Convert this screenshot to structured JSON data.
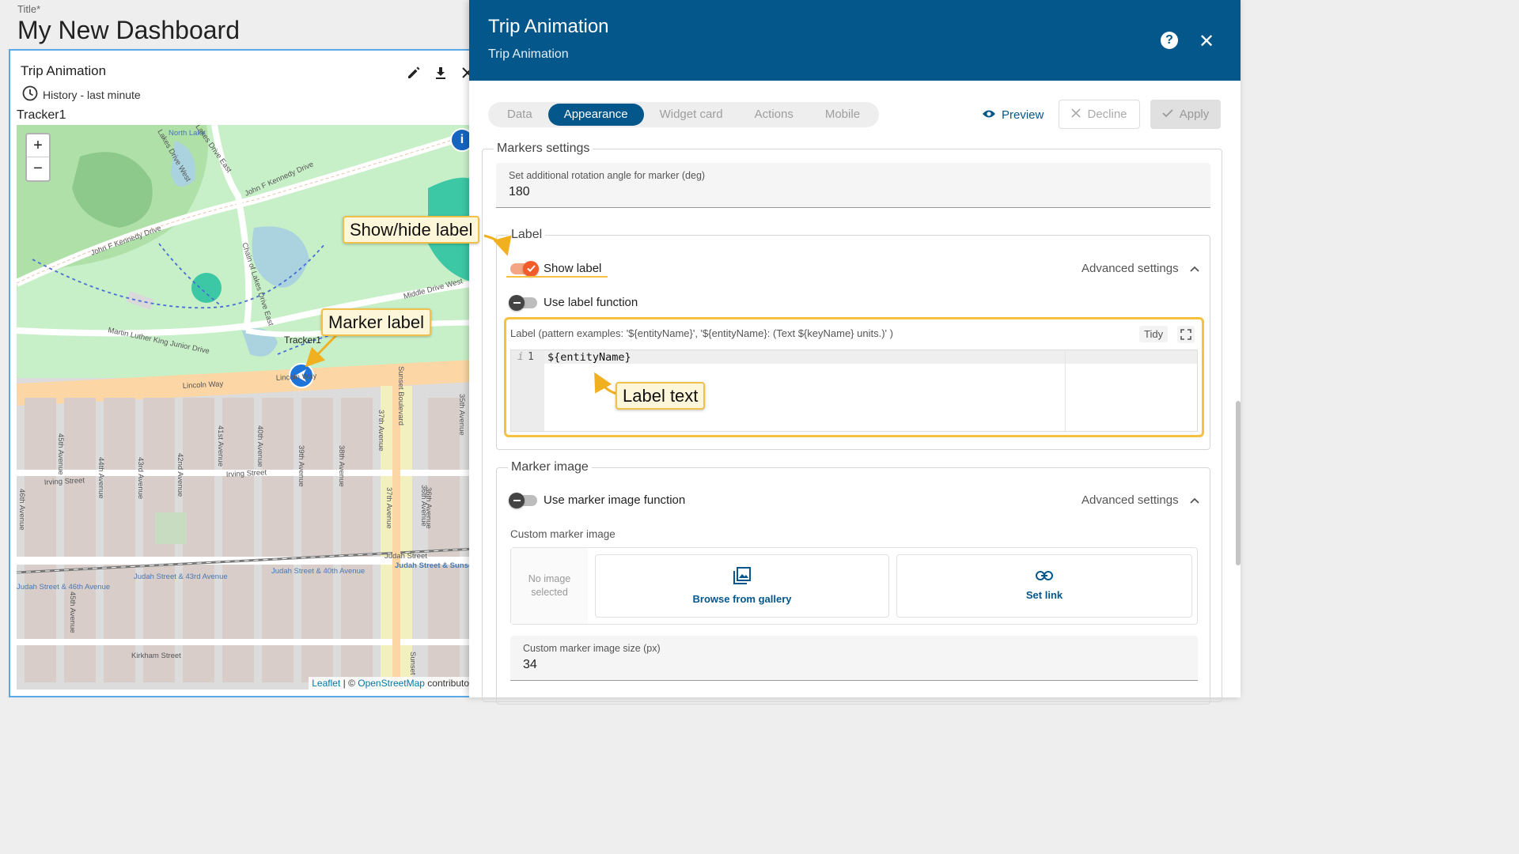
{
  "dashboard": {
    "title_label": "Title*",
    "title": "My New Dashboard"
  },
  "widget": {
    "title": "Trip Animation",
    "timewindow": "History - last minute",
    "entity_name": "Tracker1",
    "actions": [
      "edit-icon",
      "download-icon",
      "close-icon"
    ]
  },
  "map": {
    "zoom_in": "+",
    "zoom_out": "−",
    "marker_label": "Tracker1",
    "info_glyph": "i",
    "attribution": {
      "leaflet": "Leaflet",
      "separator": " | © ",
      "osm": "OpenStreetMap",
      "suffix": " contributor"
    },
    "streets": [
      "John F Kennedy Drive",
      "John F Kennedy Drive",
      "Chain of Lakes Drive East",
      "Middle Drive West",
      "Martin Luther King Junior Drive",
      "Lincoln Way",
      "Lincoln Way",
      "Irving Street",
      "Irving Street",
      "Judah Street",
      "Kirkham Street",
      "Sunset Boulevard",
      "45th Avenue",
      "44th Avenue",
      "43rd Avenue",
      "42nd Avenue",
      "41st Avenue",
      "40th Avenue",
      "39th Avenue",
      "38th Avenue",
      "37th Avenue",
      "36th Avenue",
      "35th Avenue",
      "46th Avenue",
      "Lakes Drive West",
      "Lakes Drive East",
      "North Lake",
      "Judah Street & 43rd Avenue",
      "Judah Street & 40th Avenue",
      "Judah Street & Sunset Boulevard",
      "Judah Street & 46th Avenue",
      "45th Avenue",
      "37th Avenue",
      "36th Avenue",
      "Sunset"
    ]
  },
  "dialog": {
    "title": "Trip Animation",
    "subtitle": "Trip Animation",
    "help_glyph": "?",
    "close_glyph": "✕",
    "tabs": [
      {
        "label": "Data",
        "active": false
      },
      {
        "label": "Appearance",
        "active": true
      },
      {
        "label": "Widget card",
        "active": false
      },
      {
        "label": "Actions",
        "active": false
      },
      {
        "label": "Mobile",
        "active": false
      }
    ],
    "preview_label": "Preview",
    "decline_label": "Decline",
    "apply_label": "Apply"
  },
  "markers_settings": {
    "legend": "Markers settings",
    "rotation": {
      "label": "Set additional rotation angle for marker (deg)",
      "value": "180"
    }
  },
  "label_section": {
    "legend": "Label",
    "show_label": {
      "text": "Show label",
      "checked": true
    },
    "advanced": "Advanced settings",
    "use_function": {
      "text": "Use label function",
      "checked": false
    },
    "editor": {
      "label": "Label (pattern examples: '${entityName}', '${entityName}: (Text ${keyName} units.)' )",
      "tidy": "Tidy",
      "line_info": "i",
      "line_number": "1",
      "code": "${entityName}"
    }
  },
  "marker_image": {
    "legend": "Marker image",
    "use_function": {
      "text": "Use marker image function",
      "checked": false
    },
    "advanced": "Advanced settings",
    "custom_image_label": "Custom marker image",
    "no_image_line1": "No image",
    "no_image_line2": "selected",
    "browse": "Browse from gallery",
    "set_link": "Set link",
    "size": {
      "label": "Custom marker image size (px)",
      "value": "34"
    }
  },
  "callouts": {
    "show_hide": "Show/hide label",
    "marker_label": "Marker label",
    "label_text": "Label text"
  },
  "colors": {
    "header": "#04578b",
    "accent": "#f25c2b",
    "highlight": "#f6c040"
  }
}
